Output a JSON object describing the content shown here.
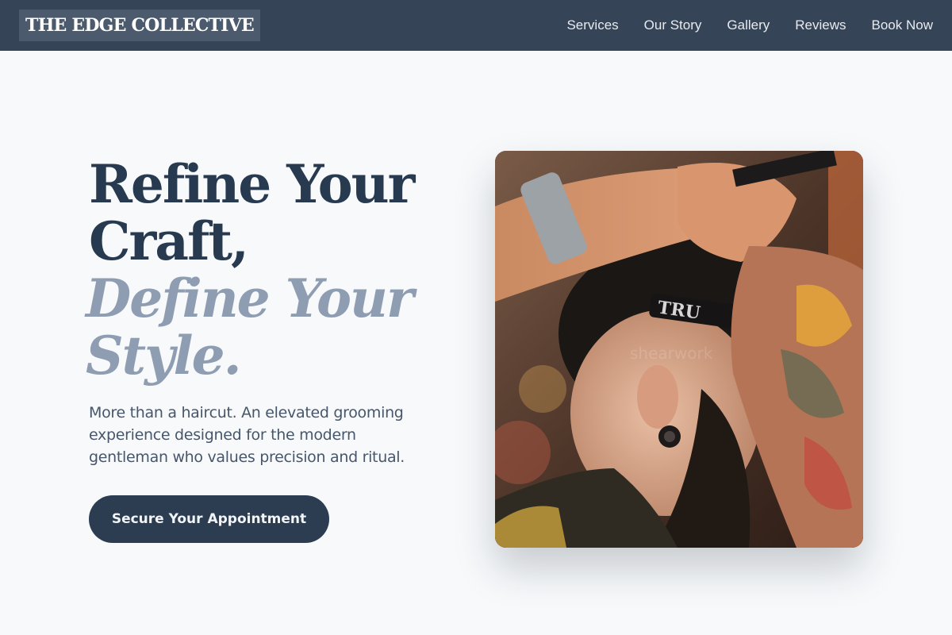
{
  "brand": {
    "name": "THE EDGE COLLECTIVE"
  },
  "nav": {
    "items": [
      {
        "label": "Services"
      },
      {
        "label": "Our Story"
      },
      {
        "label": "Gallery"
      },
      {
        "label": "Reviews"
      },
      {
        "label": "Book Now"
      }
    ]
  },
  "hero": {
    "headline_line1": "Refine Your",
    "headline_line2": "Craft,",
    "headline_line3": "Define Your",
    "headline_line4": "Style.",
    "lede": "More than a haircut. An elevated grooming experience designed for the modern gentleman who values precision and ritual.",
    "cta_label": "Secure Your Appointment"
  },
  "photo": {
    "razor_brand": "TRU",
    "watermark": "shearwork"
  },
  "colors": {
    "header_bg": "#354457",
    "page_bg": "#f7f9fb",
    "headline": "#283a50",
    "headline_accent": "#8e9db2",
    "cta_bg": "#2c3d52"
  }
}
